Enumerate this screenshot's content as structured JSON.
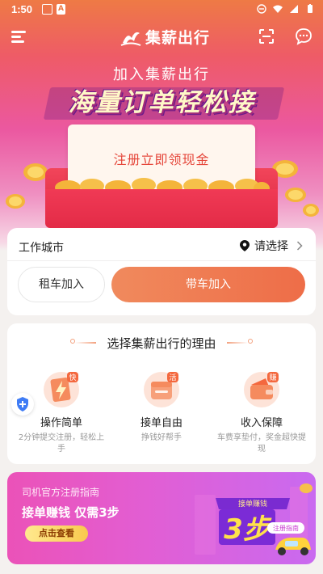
{
  "status_bar": {
    "time": "1:50",
    "notif_letter": "A"
  },
  "app_bar": {
    "brand_name": "集薪出行"
  },
  "banner": {
    "subtitle": "加入集薪出行",
    "title": "海量订单轻松接",
    "card_text": "注册立即领现金"
  },
  "city_card": {
    "label": "工作城市",
    "select_text": "请选择",
    "rent_button": "租车加入",
    "own_car_button": "带车加入"
  },
  "reasons": {
    "title": "选择集薪出行的理由",
    "items": [
      {
        "badge": "快",
        "label": "操作简单",
        "desc": "2分钟提交注册，轻松上手",
        "icon": "lightning-card-icon"
      },
      {
        "badge": "活",
        "label": "接单自由",
        "desc": "挣钱好帮手",
        "icon": "bag-card-icon"
      },
      {
        "badge": "赚",
        "label": "收入保障",
        "desc": "车费享垫付，奖金超快提现",
        "icon": "wallet-icon"
      }
    ]
  },
  "guide": {
    "top_text": "司机官方注册指南",
    "title": "接单赚钱 仅需3步",
    "button": "点击查看",
    "art_ribbon": "接单赚钱",
    "art_number": "3步",
    "art_tag": "注册指南"
  },
  "colors": {
    "brand_orange": "#ee6d48",
    "accent_pink": "#eb58a0",
    "packet_red": "#e32b47"
  }
}
